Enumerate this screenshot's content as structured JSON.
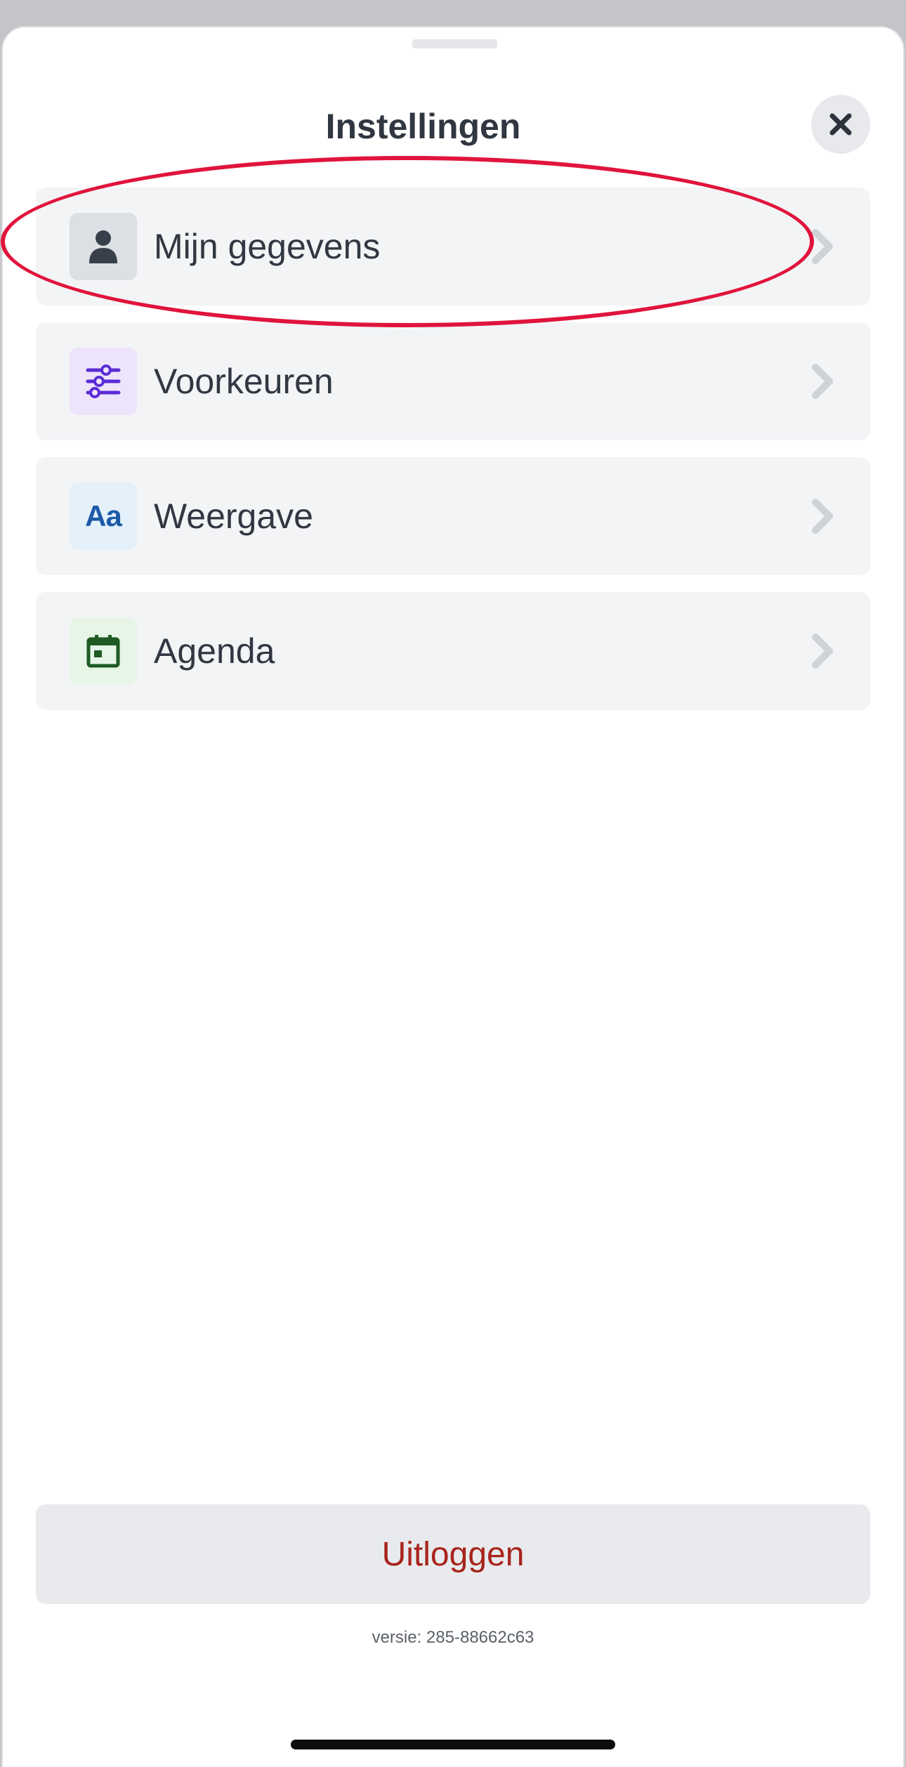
{
  "sheet": {
    "title": "Instellingen",
    "close_icon": "close-icon"
  },
  "menu": {
    "items": [
      {
        "label": "Mijn gegevens",
        "icon": "person-icon",
        "icon_bg": "#dcdfe3",
        "icon_color": "#37404a",
        "highlighted": true
      },
      {
        "label": "Voorkeuren",
        "icon": "sliders-icon",
        "icon_bg": "#ede4fb",
        "icon_color": "#5b2bd6"
      },
      {
        "label": "Weergave",
        "icon": "text-size-icon",
        "icon_text": "Aa",
        "icon_bg": "#e4f1fb",
        "icon_color": "#1c5aa8"
      },
      {
        "label": "Agenda",
        "icon": "calendar-icon",
        "icon_bg": "#e6f5e6",
        "icon_color": "#1e5a22"
      }
    ],
    "chevron_icon": "chevron-right-icon",
    "highlight_color": "#e0143c"
  },
  "footer": {
    "logout_label": "Uitloggen",
    "logout_color": "#a8241c",
    "version": "versie: 285-88662c63"
  }
}
